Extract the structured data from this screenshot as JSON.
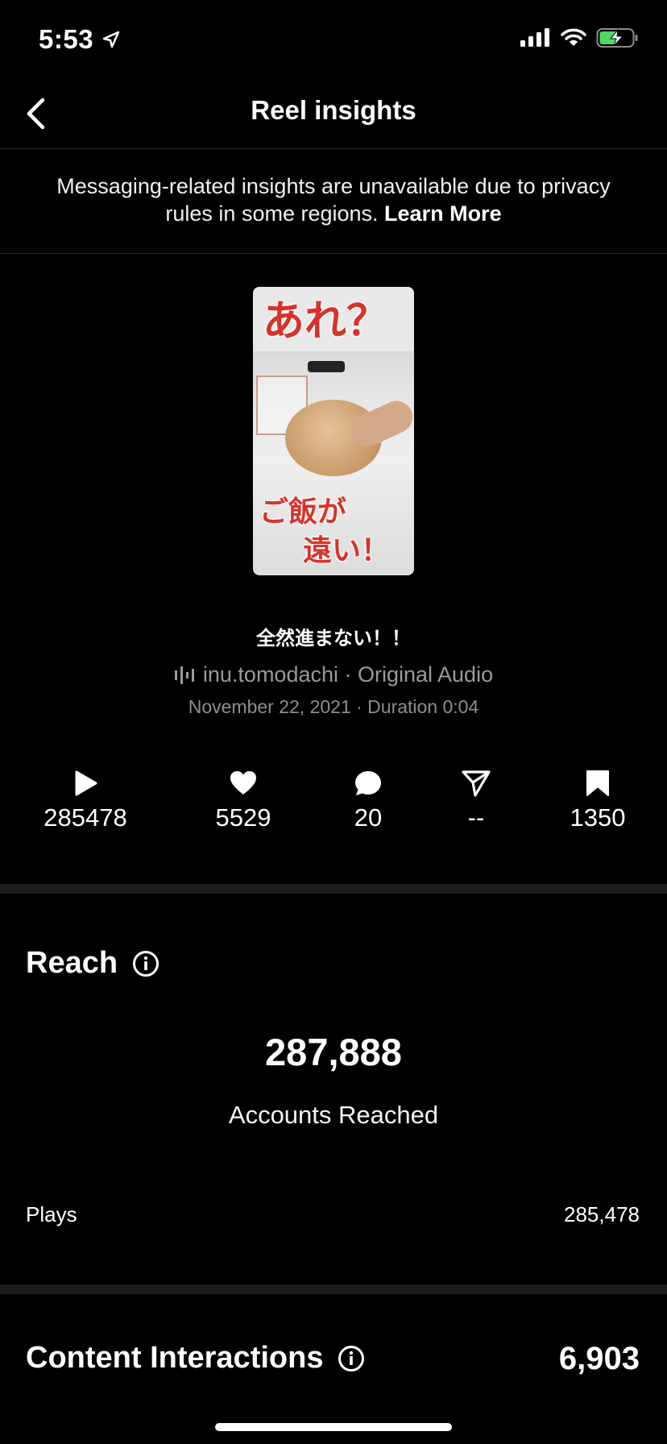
{
  "status_bar": {
    "time": "5:53"
  },
  "nav": {
    "title": "Reel insights"
  },
  "notice": {
    "text": "Messaging-related insights are unavailable due to privacy rules in some regions.",
    "link": "Learn More"
  },
  "thumbnail": {
    "top_text": "あれ？",
    "bottom_text_1": "ご飯が",
    "bottom_text_2": "遠い！"
  },
  "post": {
    "caption": "全然進まない！！",
    "audio": "inu.tomodachi · Original Audio",
    "date_duration": "November 22, 2021 · Duration 0:04"
  },
  "stats": {
    "plays": "285478",
    "likes": "5529",
    "comments": "20",
    "shares": "--",
    "saves": "1350"
  },
  "reach": {
    "title": "Reach",
    "accounts_reached_value": "287,888",
    "accounts_reached_label": "Accounts Reached",
    "plays_label": "Plays",
    "plays_value": "285,478"
  },
  "content_interactions": {
    "title": "Content Interactions",
    "value": "6,903"
  },
  "colors": {
    "background": "#000000",
    "secondary_text": "#9a9a9a",
    "divider": "#1c1c1c"
  }
}
